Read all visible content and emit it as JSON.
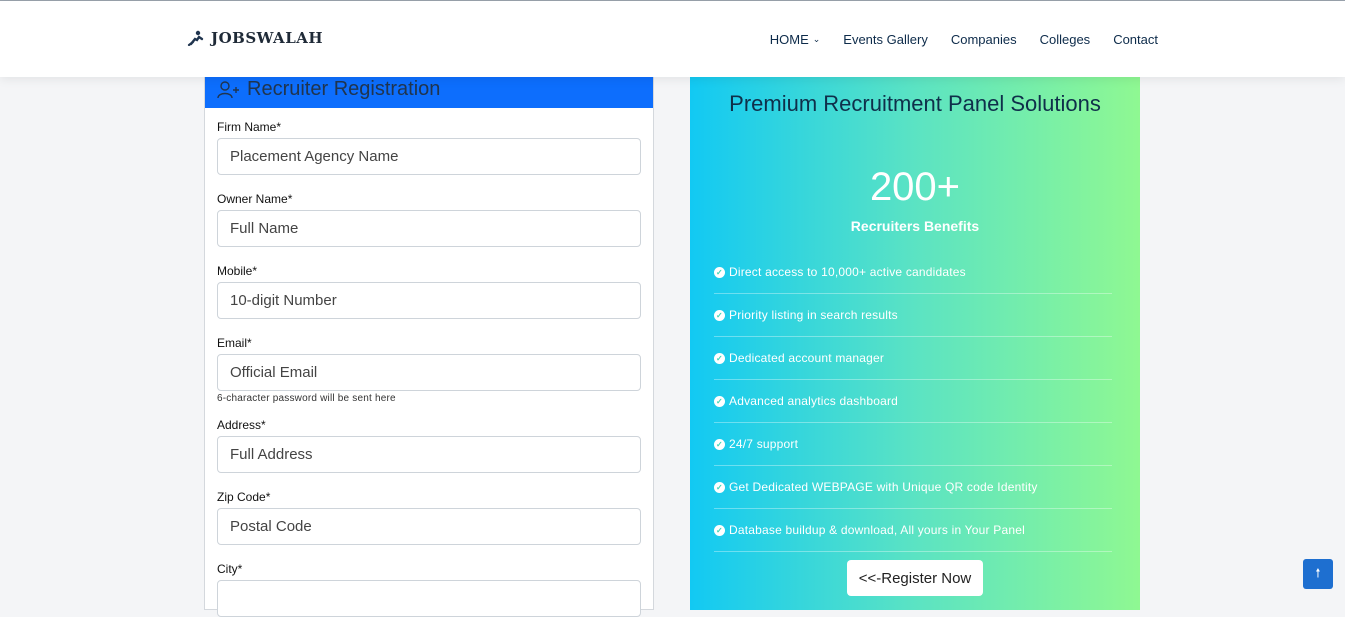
{
  "brand": {
    "name": "JOBSWALAH",
    "icon": "person-walking-icon"
  },
  "nav": {
    "items": [
      {
        "label": "HOME",
        "dropdown": true
      },
      {
        "label": "Events Gallery"
      },
      {
        "label": "Companies"
      },
      {
        "label": "Colleges"
      },
      {
        "label": "Contact"
      }
    ]
  },
  "form": {
    "title": "Recruiter Registration",
    "icon": "user-plus-icon",
    "fields": [
      {
        "label": "Firm Name*",
        "placeholder": "Placement Agency Name"
      },
      {
        "label": "Owner Name*",
        "placeholder": "Full Name"
      },
      {
        "label": "Mobile*",
        "placeholder": "10-digit Number"
      },
      {
        "label": "Email*",
        "placeholder": "Official Email",
        "hint": "6-character password will be sent here"
      },
      {
        "label": "Address*",
        "placeholder": "Full Address"
      },
      {
        "label": "Zip Code*",
        "placeholder": "Postal Code"
      },
      {
        "label": "City*",
        "placeholder": ""
      }
    ]
  },
  "panel": {
    "title": "Premium Recruitment Panel Solutions",
    "count": "200+",
    "subtitle": "Recruiters Benefits",
    "benefits": [
      "Direct access to 10,000+ active candidates",
      "Priority listing in search results",
      "Dedicated account manager",
      "Advanced analytics dashboard",
      "24/7 support",
      "Get Dedicated WEBPAGE with Unique QR code Identity",
      "Database buildup & download, All yours in Your Panel"
    ],
    "button": "<<-Register Now"
  },
  "scroll_top": {
    "icon": "arrow-up-icon"
  },
  "colors": {
    "header_bar": "#0d6efd",
    "panel_start": "#12c9f3",
    "panel_end": "#8ff892",
    "scroll_btn": "#1e6fd0"
  }
}
